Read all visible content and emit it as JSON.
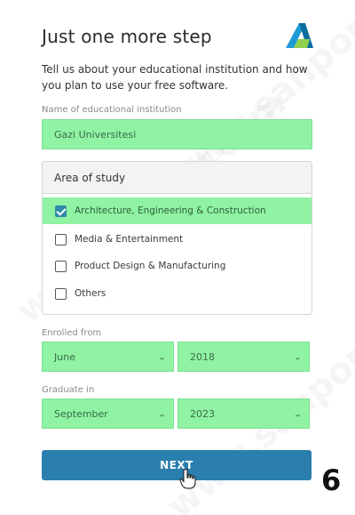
{
  "header": {
    "title": "Just one more step"
  },
  "description": "Tell us about your educational institution and how you plan to use your free software.",
  "institution": {
    "label": "Name of educational institution",
    "value": "Gazi Universitesi"
  },
  "study": {
    "header": "Area of study",
    "options": [
      {
        "label": "Architecture, Engineering & Construction",
        "checked": true
      },
      {
        "label": "Media & Entertainment",
        "checked": false
      },
      {
        "label": "Product Design & Manufacturing",
        "checked": false
      },
      {
        "label": "Others",
        "checked": false
      }
    ]
  },
  "enrolled": {
    "label": "Enrolled from",
    "month": "June",
    "year": "2018"
  },
  "graduate": {
    "label": "Graduate in",
    "month": "September",
    "year": "2023"
  },
  "next_label": "NEXT",
  "step_number": "6",
  "watermark": "www.sanpor.com",
  "colors": {
    "highlight": "#8ff3a3",
    "button": "#2a7fae",
    "checkbox": "#2e8aa8"
  }
}
